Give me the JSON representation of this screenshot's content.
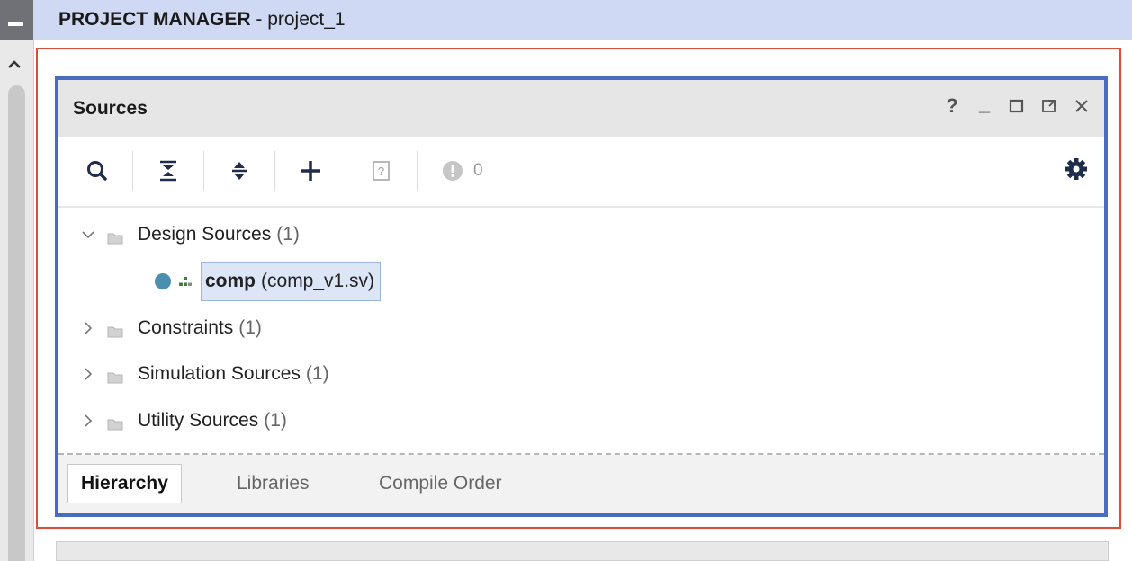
{
  "header": {
    "title": "PROJECT MANAGER",
    "separator": " - ",
    "project": "project_1"
  },
  "panel": {
    "title": "Sources",
    "window_controls": [
      {
        "name": "help",
        "glyph": "?"
      },
      {
        "name": "minimize",
        "glyph": "_"
      },
      {
        "name": "maximize",
        "glyph": "□"
      },
      {
        "name": "float",
        "glyph": "⧉"
      },
      {
        "name": "close",
        "glyph": "✕"
      }
    ],
    "toolbar": {
      "icons": [
        "search-icon",
        "collapse-all-icon",
        "expand-all-icon",
        "add-icon",
        "unknown-file-icon",
        "status-dot-icon",
        "gear-icon"
      ],
      "message_count": "0"
    },
    "tree": {
      "design_sources": {
        "label": "Design Sources",
        "count": "(1)"
      },
      "child": {
        "name": "comp",
        "file": "(comp_v1.sv)"
      },
      "constraints": {
        "label": "Constraints",
        "count": "(1)"
      },
      "simulation": {
        "label": "Simulation Sources",
        "count": "(1)"
      },
      "utility": {
        "label": "Utility Sources",
        "count": "(1)"
      }
    },
    "tabs": {
      "hierarchy": "Hierarchy",
      "libraries": "Libraries",
      "compile_order": "Compile Order"
    }
  },
  "colors": {
    "header_bg": "#cfd9f3",
    "panel_border": "#4a6cc0",
    "highlight_border": "#e04b3c",
    "status_dot": "#4a8fb0"
  }
}
